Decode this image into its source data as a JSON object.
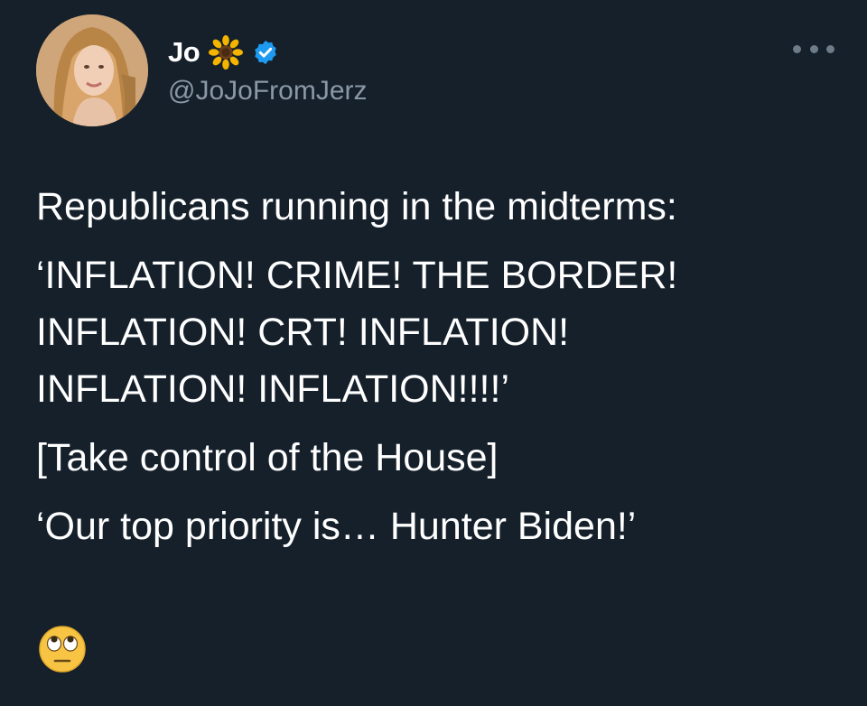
{
  "author": {
    "display_name": "Jo",
    "handle": "@JoJoFromJerz",
    "name_emoji": "sunflower-icon",
    "verified": true
  },
  "menu": {
    "icon": "more-horizontal-icon"
  },
  "tweet": {
    "lines": [
      "Republicans running in the midterms:",
      "‘INFLATION! CRIME! THE BORDER!",
      "INFLATION! CRT! INFLATION!",
      "INFLATION! INFLATION!!!!’",
      "[Take control of the House]",
      "‘Our top priority is… Hunter Biden!’"
    ],
    "trailing_emoji": "face-with-rolling-eyes-icon"
  },
  "colors": {
    "background": "#15202b",
    "text": "#ffffff",
    "secondary_text": "#8b98a5",
    "verified_blue": "#1d9bf0"
  }
}
